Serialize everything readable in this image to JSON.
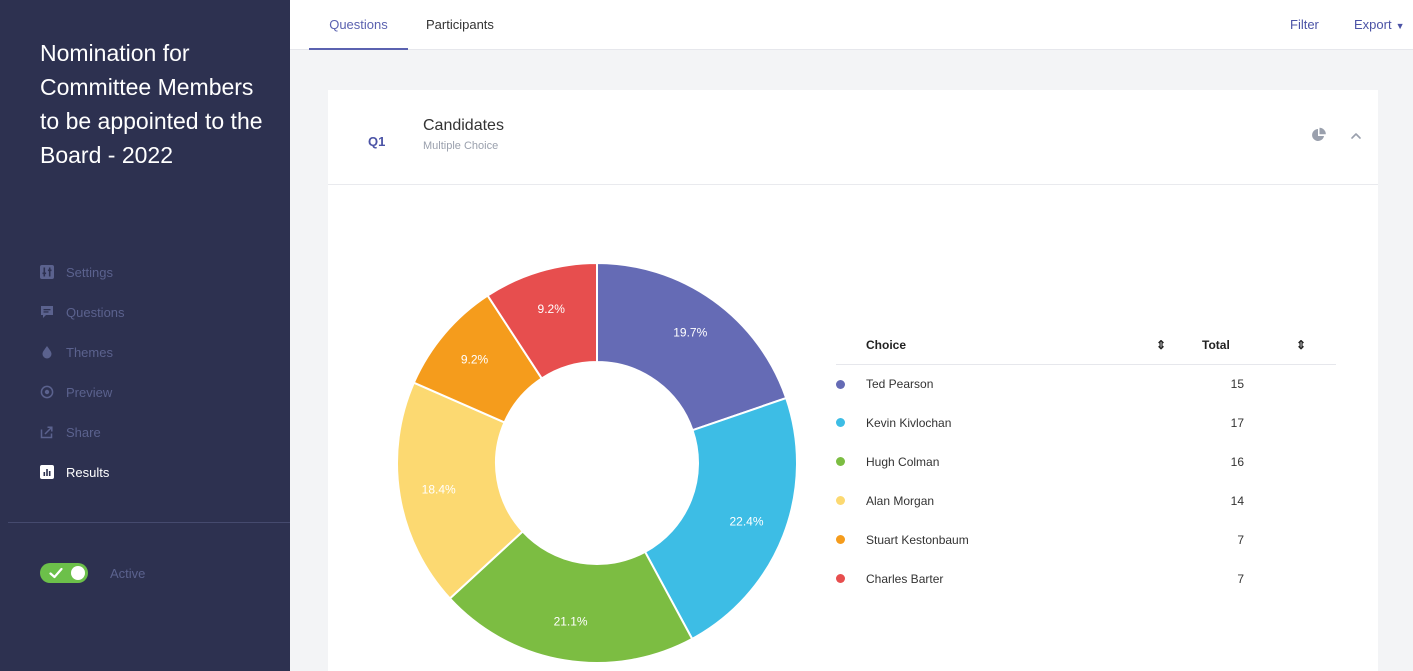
{
  "sidebar": {
    "title": "Nomination for Committee Members to be appointed to the Board - 2022",
    "items": [
      {
        "label": "Settings",
        "icon": "settings-icon",
        "active": false
      },
      {
        "label": "Questions",
        "icon": "questions-icon",
        "active": false
      },
      {
        "label": "Themes",
        "icon": "themes-icon",
        "active": false
      },
      {
        "label": "Preview",
        "icon": "preview-icon",
        "active": false
      },
      {
        "label": "Share",
        "icon": "share-icon",
        "active": false
      },
      {
        "label": "Results",
        "icon": "results-icon",
        "active": true
      }
    ],
    "status_label": "Active",
    "status_on": true
  },
  "topbar": {
    "tabs": [
      "Questions",
      "Participants"
    ],
    "active_tab": "Questions",
    "filter_label": "Filter",
    "export_label": "Export"
  },
  "question": {
    "number": "Q1",
    "title": "Candidates",
    "type": "Multiple Choice"
  },
  "table": {
    "headers": [
      "Choice",
      "Total"
    ]
  },
  "colors": {
    "sidebar_bg": "#2d3150",
    "accent": "#5b62b0",
    "toggle_on": "#6cc04a"
  },
  "chart_data": {
    "type": "pie",
    "donut": true,
    "categories": [
      "Ted Pearson",
      "Kevin Kivlochan",
      "Hugh Colman",
      "Alan Morgan",
      "Stuart Kestonbaum",
      "Charles Barter"
    ],
    "values": [
      15,
      17,
      16,
      14,
      7,
      7
    ],
    "percent_labels": [
      "19.7%",
      "22.4%",
      "21.1%",
      "18.4%",
      "9.2%",
      "9.2%"
    ],
    "colors": [
      "#656bb5",
      "#3dbde5",
      "#7cbd42",
      "#fcd971",
      "#f59c1c",
      "#e74e4e"
    ],
    "label_colors": [
      "#ffffff",
      "#ffffff",
      "#ffffff",
      "#ffffff",
      "#ffffff",
      "#ffffff"
    ]
  }
}
